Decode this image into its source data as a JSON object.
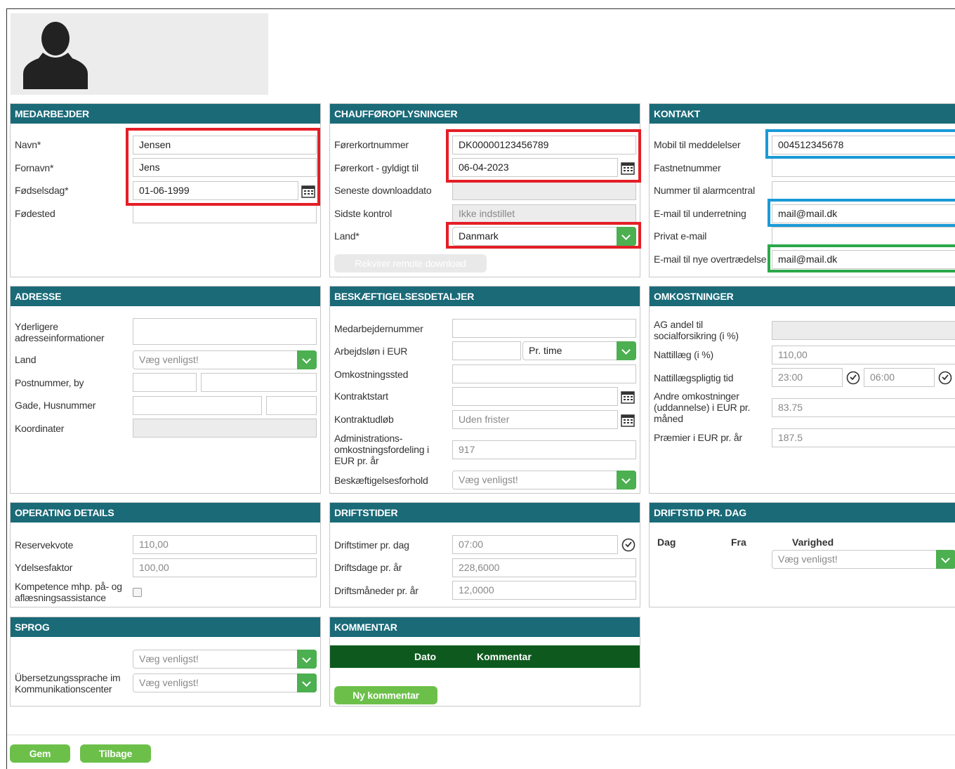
{
  "medarbejder": {
    "title": "MEDARBEJDER",
    "navn_label": "Navn*",
    "navn_value": "Jensen",
    "fornavn_label": "Fornavn*",
    "fornavn_value": "Jens",
    "foedselsdag_label": "Fødselsdag*",
    "foedselsdag_value": "01-06-1999",
    "foedested_label": "Fødested",
    "foedested_value": ""
  },
  "chauffoer": {
    "title": "CHAUFFØROPLYSNINGER",
    "kort_label": "Førerkortnummer",
    "kort_value": "DK00000123456789",
    "gyldig_label": "Førerkort - gyldigt til",
    "gyldig_value": "06-04-2023",
    "download_label": "Seneste downloaddato",
    "download_value": "",
    "kontrol_label": "Sidste kontrol",
    "kontrol_value": "Ikke indstillet",
    "land_label": "Land*",
    "land_value": "Danmark",
    "remote_button": "Rekvirer remote download"
  },
  "kontakt": {
    "title": "KONTAKT",
    "mobil_label": "Mobil til meddelelser",
    "mobil_value": "004512345678",
    "fastnet_label": "Fastnetnummer",
    "fastnet_value": "",
    "alarm_label": "Nummer til alarmcentral",
    "alarm_value": "",
    "email_label": "E-mail til underretning",
    "email_value": "mail@mail.dk",
    "privat_label": "Privat e-mail",
    "privat_value": "",
    "overtraedelse_label": "E-mail til nye overtrædelse",
    "overtraedelse_value": "mail@mail.dk"
  },
  "adresse": {
    "title": "ADRESSE",
    "yderligere_label": "Yderligere adresseinformationer",
    "land_label": "Land",
    "land_placeholder": "Væg venligst!",
    "postnr_label": "Postnummer, by",
    "gade_label": "Gade, Husnummer",
    "koord_label": "Koordinater"
  },
  "beskaeftigelse": {
    "title": "BESKÆFTIGELSESDETALJER",
    "medarbejdernr_label": "Medarbejdernummer",
    "loen_label": "Arbejdsløn i EUR",
    "loen_unit": "Pr. time",
    "omkost_label": "Omkostningssted",
    "start_label": "Kontraktstart",
    "udloeb_label": "Kontraktudløb",
    "udloeb_placeholder": "Uden frister",
    "admin_label": "Administrations-omkostningsfordeling i EUR pr. år",
    "admin_placeholder": "917",
    "forhold_label": "Beskæftigelsesforhold",
    "forhold_placeholder": "Væg venligst!"
  },
  "omkostninger": {
    "title": "OMKOSTNINGER",
    "ag_label": "AG andel til socialforsikring (i %)",
    "natt_label": "Nattillæg (i %)",
    "natt_placeholder": "110,00",
    "natt_tid_label": "Nattillægspligtig tid",
    "natt_fra": "23:00",
    "natt_til": "06:00",
    "andre_label": "Andre omkostninger (uddannelse) i EUR pr. måned",
    "andre_placeholder": "83.75",
    "praemier_label": "Præmier i EUR pr. år",
    "praemier_placeholder": "187.5"
  },
  "operating": {
    "title": "OPERATING DETAILS",
    "reserve_label": "Reservekvote",
    "reserve_placeholder": "110,00",
    "ydelse_label": "Ydelsesfaktor",
    "ydelse_placeholder": "100,00",
    "kompetence_label": "Kompetence mhp. på- og aflæsningsassistance"
  },
  "driftstider": {
    "title": "DRIFTSTIDER",
    "timer_label": "Driftstimer pr. dag",
    "timer_placeholder": "07:00",
    "dage_label": "Driftsdage pr. år",
    "dage_placeholder": "228,6000",
    "maaneder_label": "Driftsmåneder pr. år",
    "maaneder_placeholder": "12,0000"
  },
  "driftstid_dag": {
    "title": "DRIFTSTID PR. DAG",
    "col_dag": "Dag",
    "col_fra": "Fra",
    "col_varighed": "Varighed",
    "varighed_placeholder": "Væg venligst!"
  },
  "sprog": {
    "title": "SPROG",
    "sprog_placeholder": "Væg venligst!",
    "overs_label": "Übersetzungssprache im Kommunikationscenter",
    "overs_placeholder": "Væg venligst!"
  },
  "kommentar": {
    "title": "KOMMENTAR",
    "col_dato": "Dato",
    "col_kommentar": "Kommentar",
    "ny_button": "Ny kommentar"
  },
  "footer": {
    "gem": "Gem",
    "tilbage": "Tilbage"
  },
  "colors": {
    "header": "#1a6a78",
    "button": "#6cc04a",
    "dropdown": "#4caf50",
    "highlight_red": "#e41e26",
    "highlight_blue": "#1a9ad6",
    "highlight_green": "#2ca84a"
  }
}
